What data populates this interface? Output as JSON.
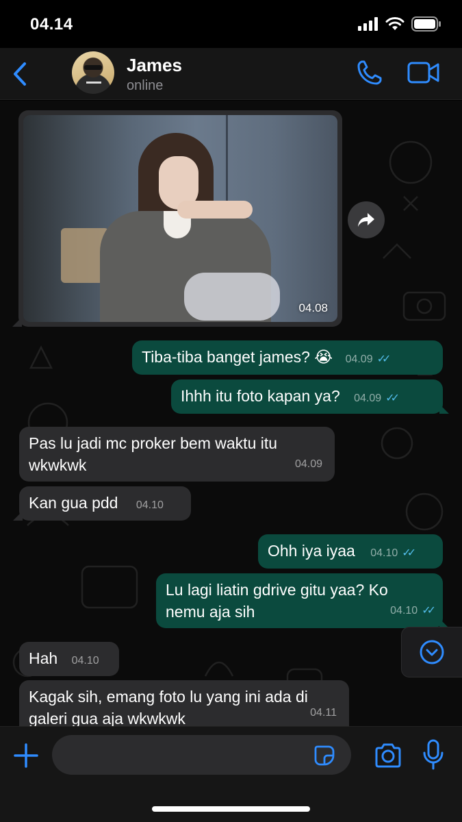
{
  "status_bar": {
    "time": "04.14"
  },
  "header": {
    "back_label": "",
    "contact_name": "James",
    "contact_status": "online"
  },
  "colors": {
    "accent": "#2f8cff",
    "outgoing_bubble": "#0b4a3e",
    "incoming_bubble": "#2c2c2e",
    "tick_read": "#53bdeb"
  },
  "messages": [
    {
      "direction": "incoming",
      "type": "image",
      "time": "04.08"
    },
    {
      "direction": "outgoing",
      "text": "Tiba-tiba banget james? 😭",
      "time": "04.09",
      "status": "read"
    },
    {
      "direction": "outgoing",
      "text": "Ihhh itu foto kapan ya?",
      "time": "04.09",
      "status": "read"
    },
    {
      "direction": "incoming",
      "text": "Pas lu jadi mc proker bem waktu itu wkwkwk",
      "time": "04.09"
    },
    {
      "direction": "incoming",
      "text": "Kan gua pdd",
      "time": "04.10"
    },
    {
      "direction": "outgoing",
      "text": "Ohh iya iyaa",
      "time": "04.10",
      "status": "read"
    },
    {
      "direction": "outgoing",
      "text": "Lu lagi liatin gdrive gitu yaa? Ko nemu aja sih",
      "time": "04.10",
      "status": "read"
    },
    {
      "direction": "incoming",
      "text": "Hah",
      "time": "04.10"
    },
    {
      "direction": "incoming",
      "text": "Kagak sih, emang foto lu yang ini ada di galeri gua aja wkwkwk",
      "time": "04.11"
    }
  ],
  "input": {
    "placeholder": "",
    "value": ""
  },
  "icons": {
    "back": "chevron-left-icon",
    "call": "phone-icon",
    "video": "video-camera-icon",
    "share": "forward-icon",
    "scroll": "chevron-down-circle-icon",
    "plus": "plus-icon",
    "sticker": "sticker-icon",
    "camera": "camera-icon",
    "mic": "microphone-icon"
  }
}
